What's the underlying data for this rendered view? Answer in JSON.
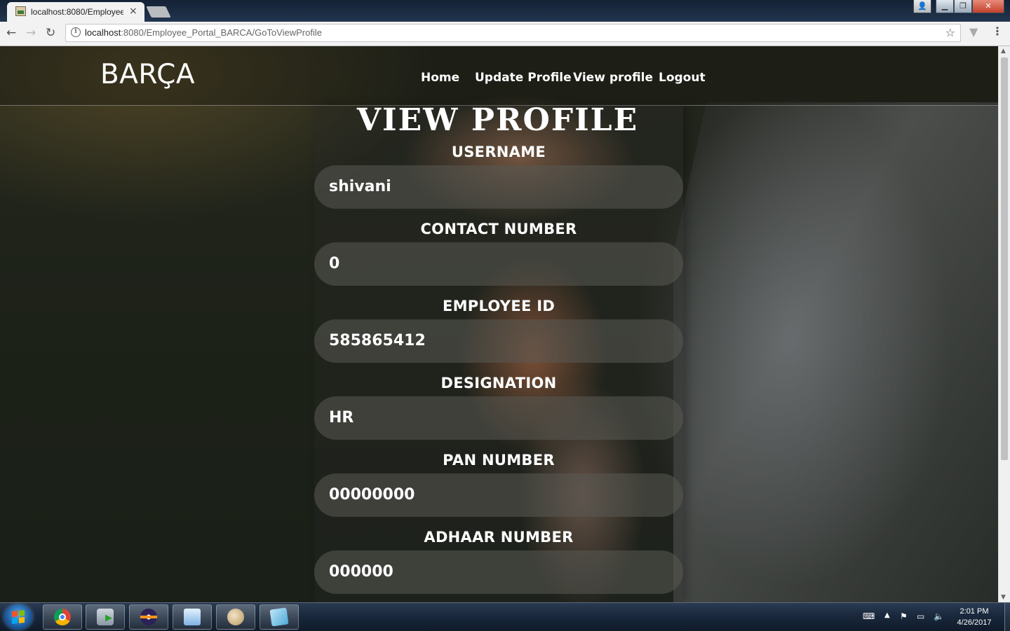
{
  "browser": {
    "tab_title": "localhost:8080/Employee",
    "tab_close": "×",
    "url_host": "localhost",
    "url_rest": ":8080/Employee_Portal_BARCA/GoToViewProfile",
    "icons": [
      "back-icon",
      "forward-icon",
      "reload-icon",
      "info-icon",
      "star-icon",
      "extension-icon",
      "menu-icon"
    ]
  },
  "header": {
    "brand": "BARÇA",
    "nav": [
      "Home",
      "Update Profile",
      "View profile",
      "Logout"
    ]
  },
  "page": {
    "title": "VIEW PROFILE",
    "fields": [
      {
        "label": "USERNAME",
        "value": "shivani"
      },
      {
        "label": "CONTACT NUMBER",
        "value": "0"
      },
      {
        "label": "EMPLOYEE ID",
        "value": "585865412"
      },
      {
        "label": "DESIGNATION",
        "value": "HR"
      },
      {
        "label": "PAN NUMBER",
        "value": "00000000"
      },
      {
        "label": "ADHAAR NUMBER",
        "value": "000000"
      }
    ]
  },
  "taskbar": {
    "apps": [
      "chrome-icon",
      "database-icon",
      "eclipse-icon",
      "files-icon",
      "paint-icon",
      "notes-icon"
    ],
    "time": "2:01 PM",
    "date": "4/26/2017"
  }
}
